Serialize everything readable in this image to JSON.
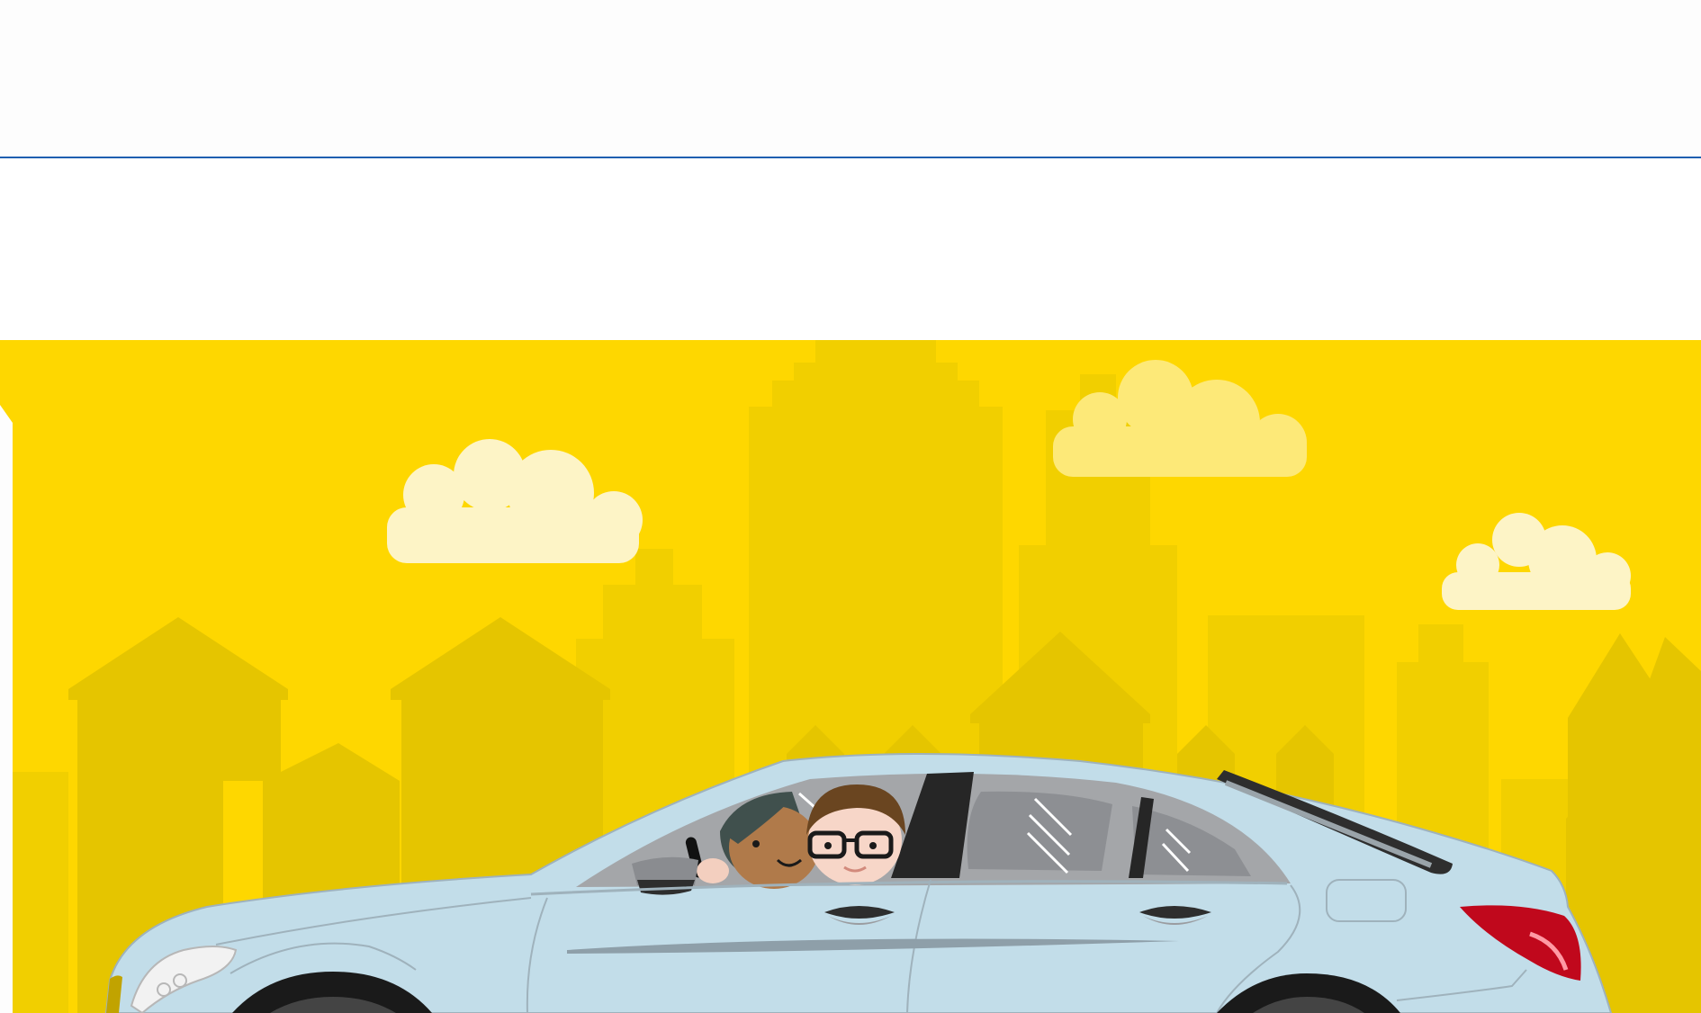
{
  "colors": {
    "header_bg": "#fdfdfd",
    "header_rule": "#1e5fb0",
    "hero_bg": "#fed700",
    "skyline_far": "#f1cf00",
    "skyline_near": "#e5c500",
    "cloud": "#fdf4c6",
    "cloud_alt": "#fde978",
    "car_body": "#c2dde9",
    "car_outline": "#9fb2bc",
    "window_glass": "#8d8f93",
    "tail_light": "#c0081c",
    "tire": "#1a1a1a"
  },
  "illustration": {
    "subject": "cartoon-car-with-two-passengers",
    "scene": "city-skyline-with-clouds"
  }
}
